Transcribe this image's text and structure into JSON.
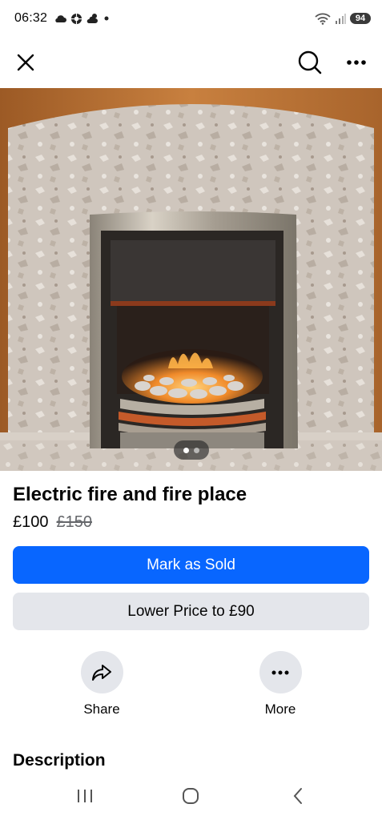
{
  "status_bar": {
    "time": "06:32",
    "battery": "94",
    "left_icons": [
      "cloud-icon",
      "aperture-icon",
      "weather-icon",
      "dot-icon"
    ],
    "right_icons": [
      "wifi-icon",
      "signal-icon",
      "battery-icon"
    ]
  },
  "top_bar": {
    "icons": [
      "close-icon",
      "search-icon",
      "more-icon"
    ]
  },
  "listing": {
    "title": "Electric fire and fire place",
    "price": "£100",
    "original_price": "£150",
    "image_count": 2,
    "current_image": 1
  },
  "buttons": {
    "mark_sold": "Mark as Sold",
    "lower_price": "Lower Price to £90"
  },
  "actions": {
    "share": "Share",
    "more": "More"
  },
  "sections": {
    "description": "Description"
  },
  "colors": {
    "primary": "#0866ff",
    "secondary_button": "#e4e6eb",
    "text": "#050505",
    "muted": "#65676b"
  },
  "nav_bar": {
    "icons": [
      "recents-icon",
      "home-icon",
      "back-icon"
    ]
  }
}
